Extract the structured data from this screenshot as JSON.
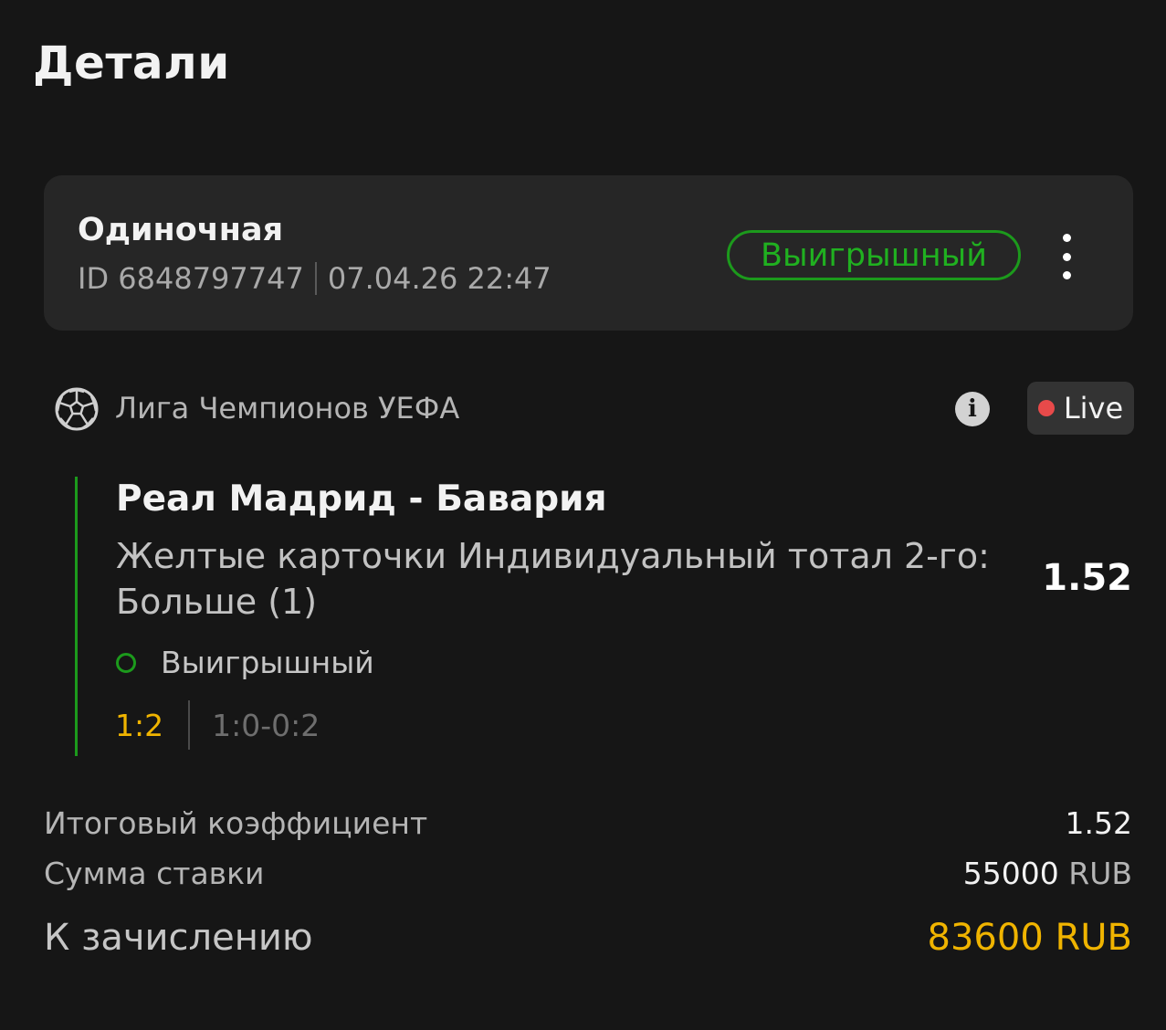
{
  "header": {
    "title": "Детали"
  },
  "bet": {
    "type": "Одиночная",
    "id_label": "ID 6848797747",
    "datetime": "07.04.26 22:47",
    "status": "Выигрышный",
    "status_color": "#20b020"
  },
  "event": {
    "sport_icon": "soccer-ball-icon",
    "league": "Лига Чемпионов УЕФА",
    "live_label": "Live",
    "live_dot_color": "#e84a4a"
  },
  "selection": {
    "match": "Реал Мадрид - Бавария",
    "market": "Желтые карточки Индивидуальный тотал 2-го: Больше (1)",
    "odds": "1.52",
    "status": "Выигрышный",
    "score": "1:2",
    "halves": "1:0-0:2",
    "accent_color": "#1c9a1c"
  },
  "summary": {
    "total_odds_label": "Итоговый коэффициент",
    "total_odds_value": "1.52",
    "stake_label": "Сумма ставки",
    "stake_amount": "55000",
    "stake_currency": "RUB",
    "payout_label": "К зачислению",
    "payout_value": "83600 RUB",
    "payout_color": "#f0b400"
  }
}
